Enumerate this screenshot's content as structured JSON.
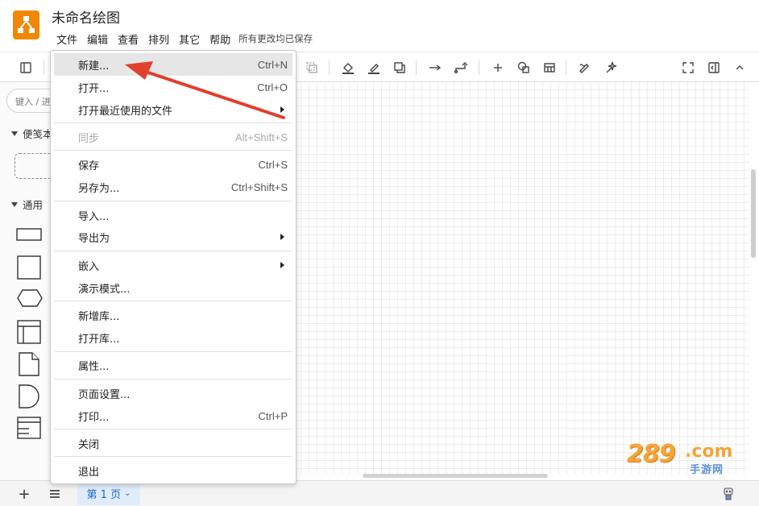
{
  "app": {
    "document_title": "未命名绘图",
    "save_status": "所有更改均已保存"
  },
  "menubar": [
    {
      "label": "文件"
    },
    {
      "label": "编辑"
    },
    {
      "label": "查看"
    },
    {
      "label": "排列"
    },
    {
      "label": "其它"
    },
    {
      "label": "帮助"
    }
  ],
  "toolbar": {
    "icons": [
      "format-panel-icon",
      "duplicate-icon",
      "fill-color-icon",
      "line-color-icon",
      "shadow-icon",
      "connection-arrow-icon",
      "waypoint-icon",
      "insert-plus-icon",
      "shapes-icon",
      "table-icon",
      "freehand-icon",
      "ai-sparkle-icon",
      "fullscreen-icon",
      "toggle-format-icon",
      "collapse-chevron-icon"
    ]
  },
  "sidebar": {
    "search_placeholder": "键入 / 进",
    "sections": [
      {
        "label": "便笺本"
      },
      {
        "label": "通用"
      }
    ]
  },
  "file_menu": {
    "items": [
      {
        "label": "新建...",
        "shortcut": "Ctrl+N",
        "highlighted": true
      },
      {
        "label": "打开...",
        "shortcut": "Ctrl+O"
      },
      {
        "label": "打开最近使用的文件",
        "submenu": true
      },
      {
        "label": "同步",
        "shortcut": "Alt+Shift+S",
        "disabled": true
      },
      {
        "label": "保存",
        "shortcut": "Ctrl+S"
      },
      {
        "label": "另存为...",
        "shortcut": "Ctrl+Shift+S"
      },
      {
        "label": "导入..."
      },
      {
        "label": "导出为",
        "submenu": true
      },
      {
        "label": "嵌入",
        "submenu": true
      },
      {
        "label": "演示模式..."
      },
      {
        "label": "新增库..."
      },
      {
        "label": "打开库..."
      },
      {
        "label": "属性..."
      },
      {
        "label": "页面设置..."
      },
      {
        "label": "打印...",
        "shortcut": "Ctrl+P"
      },
      {
        "label": "关闭"
      },
      {
        "label": "退出"
      }
    ]
  },
  "bottombar": {
    "add_label": "+",
    "page_tab_label": "第 1 页"
  },
  "watermark": {
    "number": "289",
    "suffix": ".com",
    "subtitle": "手游网"
  },
  "colors": {
    "brand": "#f08705",
    "annotation_arrow": "#e0402e",
    "page_tab_bg": "#e1ecfa",
    "page_tab_text": "#1a66c9"
  }
}
